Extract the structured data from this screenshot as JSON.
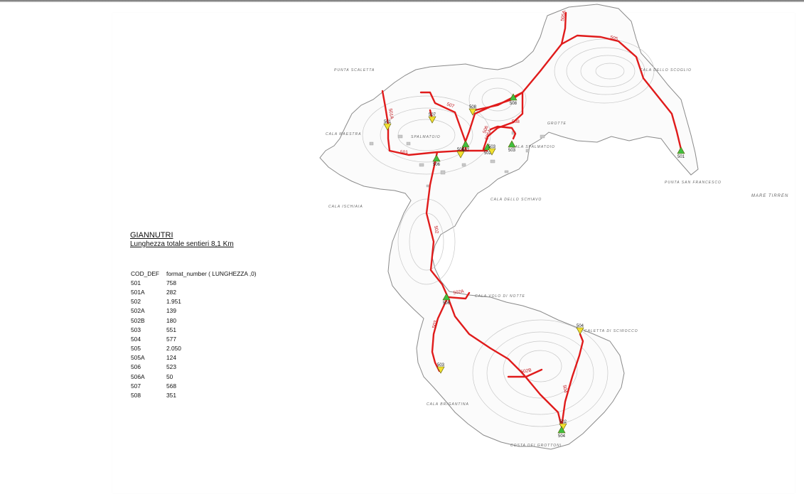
{
  "map_title": "GIANNUTRI",
  "map_subtitle": "Lunghezza totale sentieri 8,1 Km",
  "table": {
    "headers": [
      "COD_DEF",
      "format_number ( LUNGHEZZA ,0)"
    ],
    "rows": [
      [
        "501",
        "758"
      ],
      [
        "501A",
        "282"
      ],
      [
        "502",
        "1.951"
      ],
      [
        "502A",
        "139"
      ],
      [
        "502B",
        "180"
      ],
      [
        "503",
        "551"
      ],
      [
        "504",
        "577"
      ],
      [
        "505",
        "2.050"
      ],
      [
        "505A",
        "124"
      ],
      [
        "506",
        "523"
      ],
      [
        "506A",
        "50"
      ],
      [
        "507",
        "568"
      ],
      [
        "508",
        "351"
      ]
    ]
  },
  "place_labels": {
    "punta_scaletta": "PUNTA SCALETTA",
    "cala_maestra": "CALA MAESTRA",
    "spalmatoio": "SPALMATOIO",
    "cala_ischiaia": "CALA ISCHIAIA",
    "cala_dello_schiavo": "CALA DELLO SCHIAVO",
    "cala_volo_di_notte": "CALA VOLO DI NOTTE",
    "cala_brigantina": "CALA BRIGANTINA",
    "cala_grotte": "GROTTE",
    "punta_san_francesco": "PUNTA SAN FRANCESCO",
    "mare_tirreno": "MARE      TIRREN",
    "caletta_scirocco": "CALETTA DI SCIROCCO",
    "costa_dei_grottoni": "COSTA DEI GROTTONI",
    "cala_spalmatoio": "CALA SPALMATOIO",
    "cala_dello_scoglio": "CALA DELLO SCOGLIO"
  },
  "trail_labels": [
    "501",
    "501A",
    "502",
    "502A",
    "502B",
    "503",
    "504",
    "505",
    "505A",
    "506",
    "506A",
    "507",
    "508"
  ],
  "markers": [
    {
      "code": "501",
      "shape": "down",
      "fill": "#f2e030"
    },
    {
      "code": "507",
      "shape": "down",
      "fill": "#f2e030"
    },
    {
      "code": "508",
      "shape": "down",
      "fill": "#f2e030"
    },
    {
      "code": "508",
      "shape": "up",
      "fill": "#3fbf3f"
    },
    {
      "code": "503",
      "shape": "up",
      "fill": "#3fbf3f"
    },
    {
      "code": "507",
      "shape": "up",
      "fill": "#3fbf3f"
    },
    {
      "code": "506",
      "shape": "up",
      "fill": "#3fbf3f"
    },
    {
      "code": "502",
      "shape": "up",
      "fill": "#3fbf3f"
    },
    {
      "code": "503",
      "shape": "down",
      "fill": "#f2e030"
    },
    {
      "code": "501",
      "shape": "up",
      "fill": "#3fbf3f"
    },
    {
      "code": "505",
      "shape": "down",
      "fill": "#f2e030"
    },
    {
      "code": "506",
      "shape": "up",
      "fill": "#3fbf3f"
    },
    {
      "code": "503",
      "shape": "down",
      "fill": "#f2e030"
    },
    {
      "code": "504",
      "shape": "down",
      "fill": "#f2e030"
    },
    {
      "code": "502",
      "shape": "down",
      "fill": "#f2e030"
    },
    {
      "code": "504",
      "shape": "up",
      "fill": "#3fbf3f"
    }
  ],
  "colors": {
    "trail": "#e01b1b",
    "coastline": "#8a8a8a",
    "contour": "#c8c8c8",
    "marker_outline": "#5a5a00"
  }
}
